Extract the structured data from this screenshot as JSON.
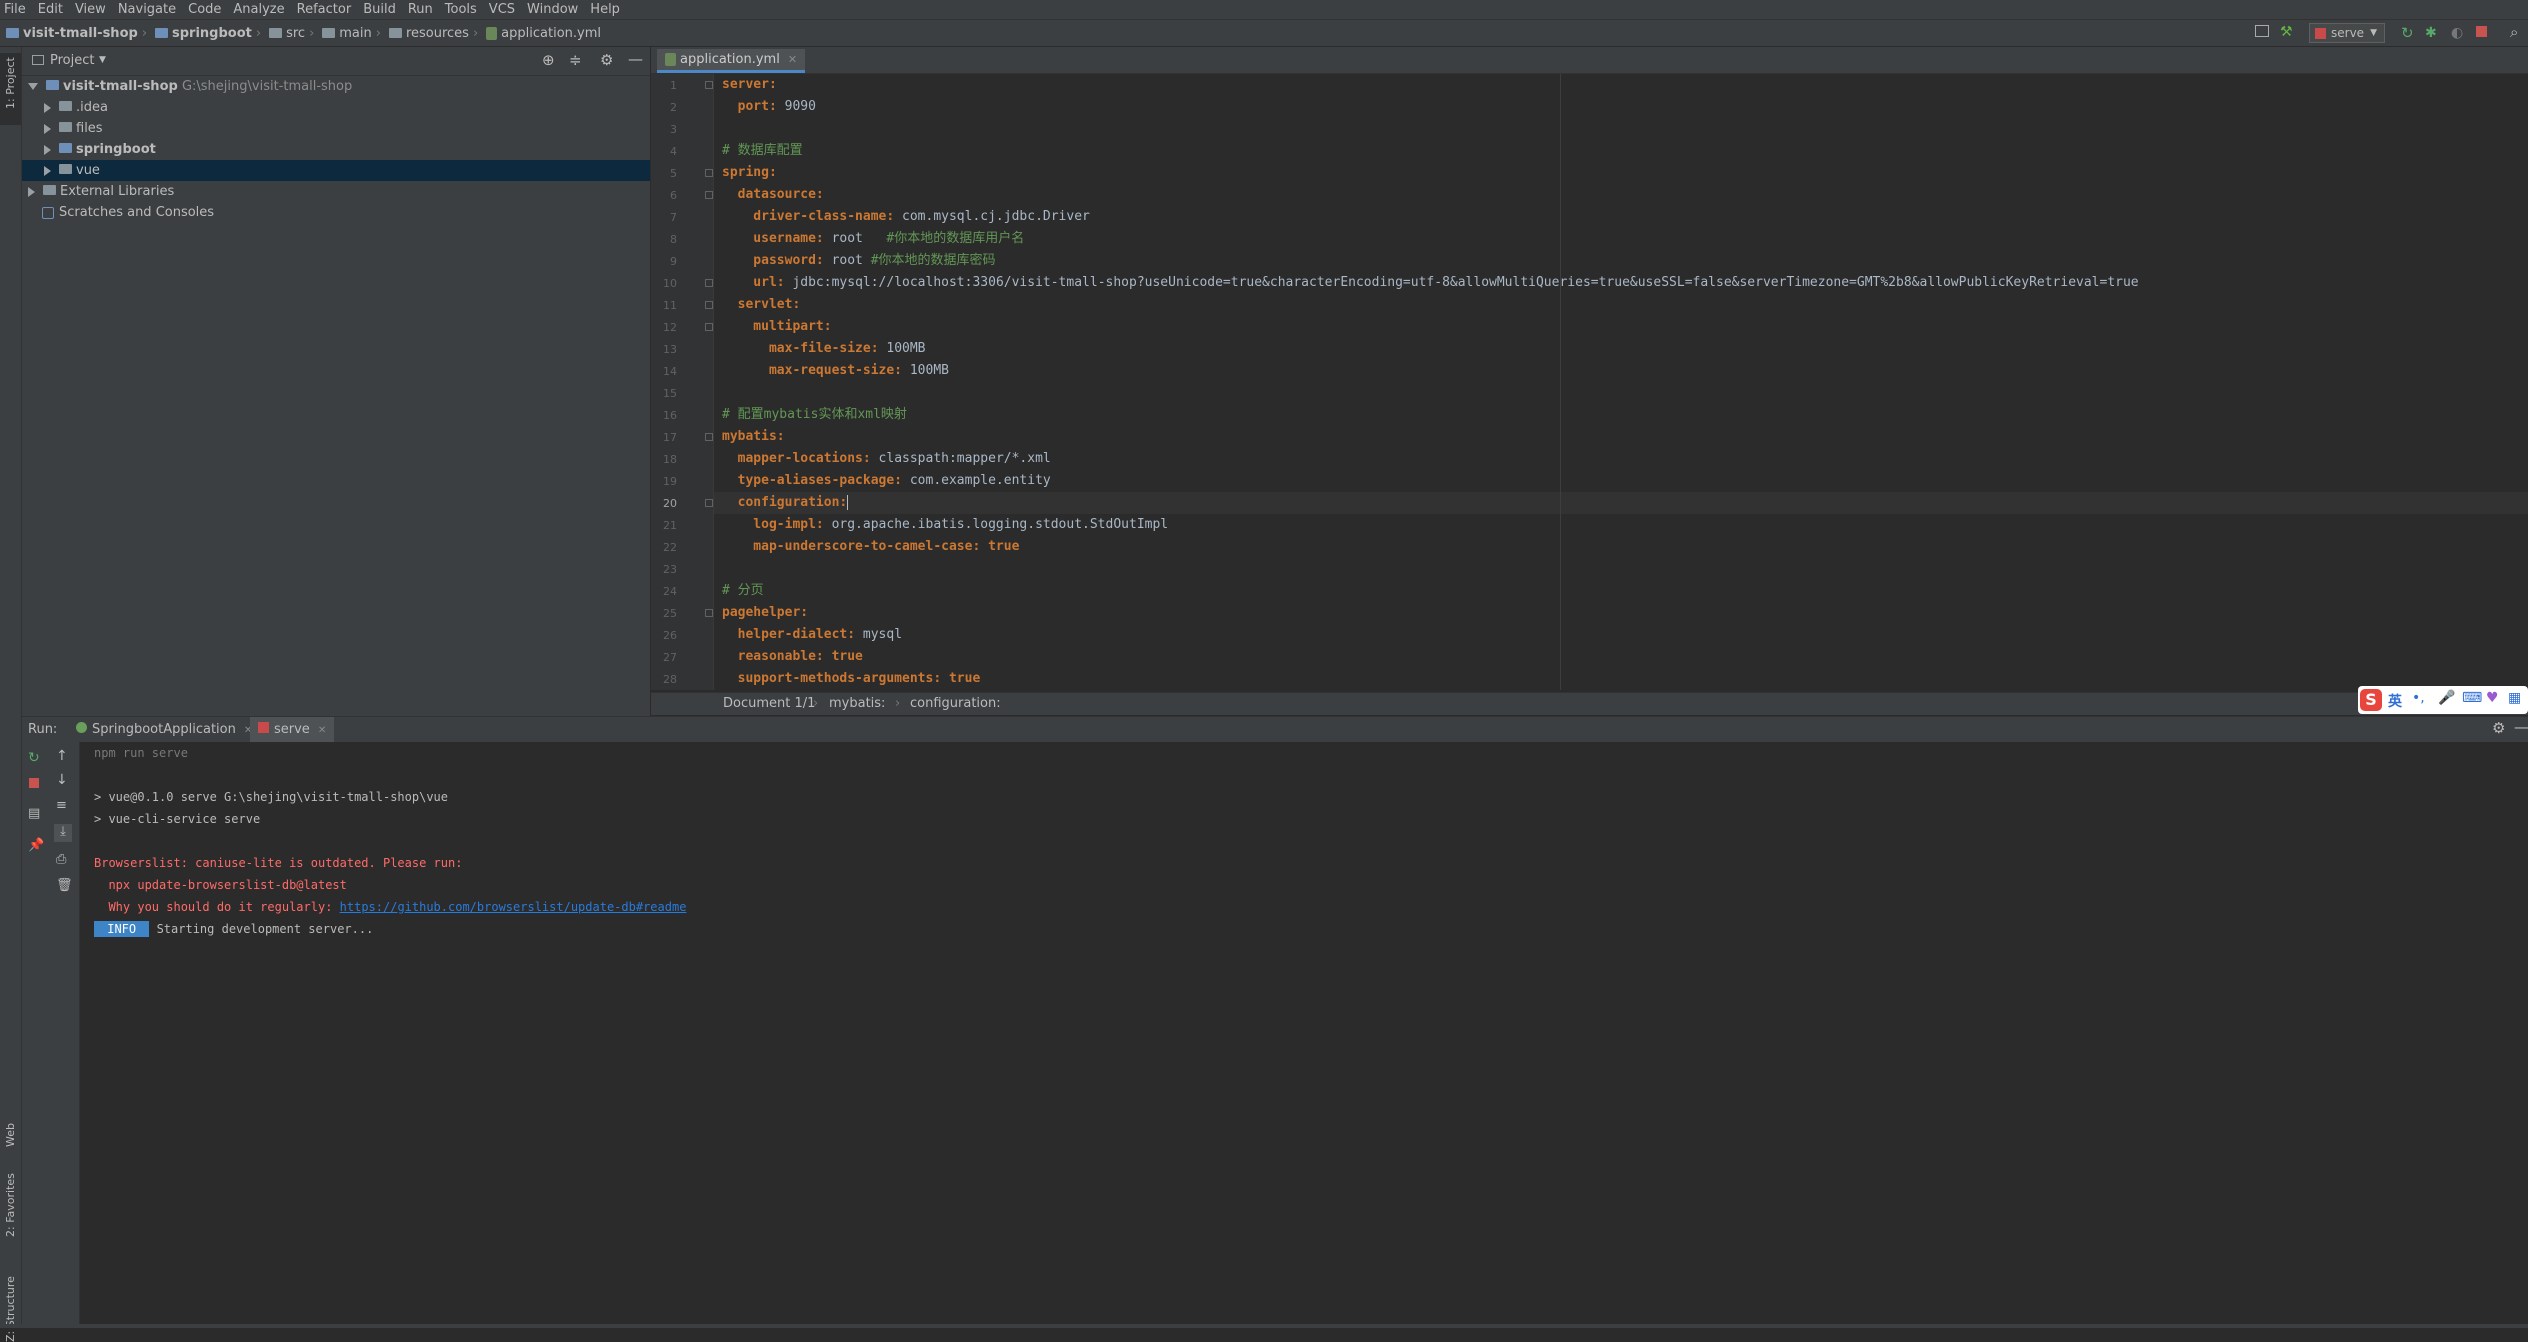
{
  "menu": [
    "File",
    "Edit",
    "View",
    "Navigate",
    "Code",
    "Analyze",
    "Refactor",
    "Build",
    "Run",
    "Tools",
    "VCS",
    "Window",
    "Help"
  ],
  "breadcrumbs": [
    "visit-tmall-shop",
    "springboot",
    "src",
    "main",
    "resources",
    "application.yml"
  ],
  "run_config": "serve",
  "side_tabs": {
    "project": "1: Project",
    "web": "Web",
    "favorites": "2: Favorites",
    "structure": "Z: Structure"
  },
  "project": {
    "header": "Project",
    "items": [
      {
        "label": "visit-tmall-shop",
        "path": "G:\\shejing\\visit-tmall-shop"
      },
      {
        "label": ".idea"
      },
      {
        "label": "files"
      },
      {
        "label": "springboot"
      },
      {
        "label": "vue"
      },
      {
        "label": "External Libraries"
      },
      {
        "label": "Scratches and Consoles"
      }
    ]
  },
  "editor": {
    "tab": "application.yml",
    "current_line": 20,
    "line_numbers": [
      "1",
      "2",
      "3",
      "4",
      "5",
      "6",
      "7",
      "8",
      "9",
      "10",
      "11",
      "12",
      "13",
      "14",
      "15",
      "16",
      "17",
      "18",
      "19",
      "20",
      "21",
      "22",
      "23",
      "24",
      "25",
      "26",
      "27",
      "28"
    ],
    "lines": [
      {
        "key": "server:",
        "val": "",
        "comment": ""
      },
      {
        "key": "  port:",
        "val": " 9090",
        "comment": ""
      },
      {
        "key": "",
        "val": "",
        "comment": ""
      },
      {
        "key": "",
        "val": "",
        "comment": "# 数据库配置"
      },
      {
        "key": "spring:",
        "val": "",
        "comment": ""
      },
      {
        "key": "  datasource:",
        "val": "",
        "comment": ""
      },
      {
        "key": "    driver-class-name:",
        "val": " com.mysql.cj.jdbc.Driver",
        "comment": ""
      },
      {
        "key": "    username:",
        "val": " root   ",
        "comment": "#你本地的数据库用户名"
      },
      {
        "key": "    password:",
        "val": " root ",
        "comment": "#你本地的数据库密码"
      },
      {
        "key": "    url:",
        "val": " jdbc:mysql://localhost:3306/visit-tmall-shop?useUnicode=true&characterEncoding=utf-8&allowMultiQueries=true&useSSL=false&serverTimezone=GMT%2b8&allowPublicKeyRetrieval=true",
        "comment": ""
      },
      {
        "key": "  servlet:",
        "val": "",
        "comment": ""
      },
      {
        "key": "    multipart:",
        "val": "",
        "comment": ""
      },
      {
        "key": "      max-file-size:",
        "val": " 100MB",
        "comment": ""
      },
      {
        "key": "      max-request-size:",
        "val": " 100MB",
        "comment": ""
      },
      {
        "key": "",
        "val": "",
        "comment": ""
      },
      {
        "key": "",
        "val": "",
        "comment": "# 配置mybatis实体和xml映射"
      },
      {
        "key": "mybatis:",
        "val": "",
        "comment": ""
      },
      {
        "key": "  mapper-locations:",
        "val": " classpath:mapper/*.xml",
        "comment": ""
      },
      {
        "key": "  type-aliases-package:",
        "val": " com.example.entity",
        "comment": ""
      },
      {
        "key": "  configuration:",
        "val": "",
        "comment": ""
      },
      {
        "key": "    log-impl:",
        "val": " org.apache.ibatis.logging.stdout.StdOutImpl",
        "comment": ""
      },
      {
        "key": "    map-underscore-to-camel-case:",
        "val": " true",
        "comment": ""
      },
      {
        "key": "",
        "val": "",
        "comment": ""
      },
      {
        "key": "",
        "val": "",
        "comment": "# 分页"
      },
      {
        "key": "pagehelper:",
        "val": "",
        "comment": ""
      },
      {
        "key": "  helper-dialect:",
        "val": " mysql",
        "comment": ""
      },
      {
        "key": "  reasonable:",
        "val": " true",
        "comment": ""
      },
      {
        "key": "  support-methods-arguments:",
        "val": " true",
        "comment": ""
      }
    ],
    "status": {
      "doc": "Document 1/1",
      "path1": "mybatis:",
      "path2": "configuration:"
    }
  },
  "run": {
    "label": "Run:",
    "tabs": [
      "SpringbootApplication",
      "serve"
    ],
    "console": {
      "cmd": "npm run serve",
      "l1": "> vue@0.1.0 serve G:\\shejing\\visit-tmall-shop\\vue",
      "l2": "> vue-cli-service serve",
      "e1": "Browserslist: caniuse-lite is outdated. Please run:",
      "e2": "  npx update-browserslist-db@latest",
      "e3": "  Why you should do it regularly: ",
      "link": "https://github.com/browserslist/update-db#readme",
      "info_badge": " INFO ",
      "info_text": " Starting development server..."
    }
  },
  "ime": {
    "label": "英"
  },
  "colors": {
    "accent": "#4a88c7",
    "key": "#cc7832",
    "comment": "#629755",
    "error": "#ff6b68",
    "link": "#287bde",
    "selection": "#0d293e"
  }
}
